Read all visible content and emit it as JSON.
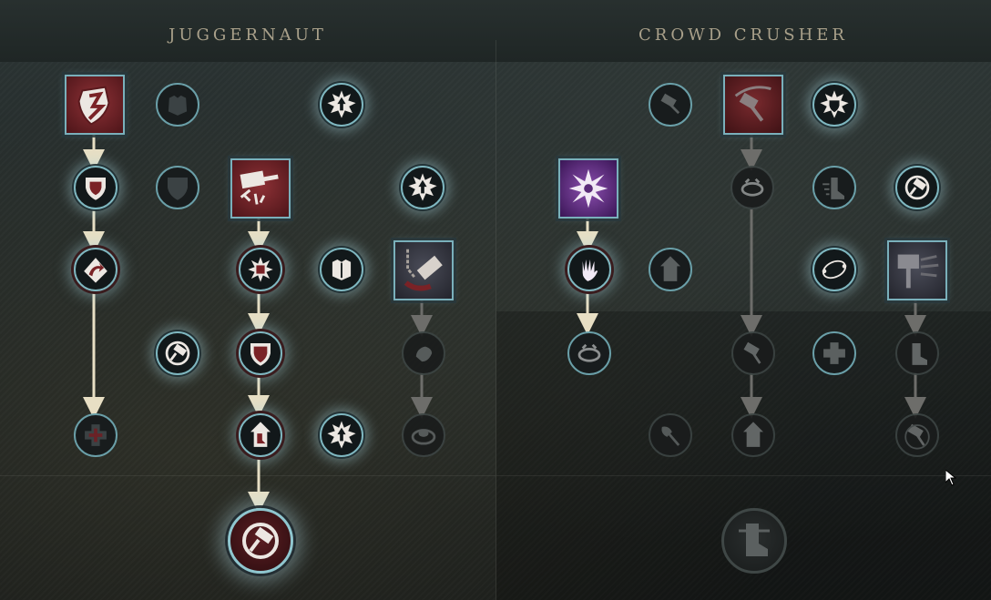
{
  "trees": {
    "left": {
      "title": "JUGGERNAUT"
    },
    "right": {
      "title": "CROWD CRUSHER"
    }
  },
  "colors": {
    "active_ring": "#7fb7c0",
    "arrow_active": "#e8dfc4",
    "arrow_locked": "#6d6d6a",
    "title": "#a9a08a"
  },
  "nodes": {
    "juggernaut": [
      {
        "id": "j-shield-square",
        "icon": "broken-shield-icon",
        "state": "active"
      },
      {
        "id": "j-armor-passive",
        "icon": "armor-icon",
        "state": "passive"
      },
      {
        "id": "j-burst-up",
        "icon": "burst-up-arrow-icon",
        "state": "active"
      },
      {
        "id": "j-shield-heart",
        "icon": "shield-heart-icon",
        "state": "active"
      },
      {
        "id": "j-shield-dark",
        "icon": "shield-icon",
        "state": "passive"
      },
      {
        "id": "j-hammer-square",
        "icon": "hammer-strike-icon",
        "state": "active"
      },
      {
        "id": "j-burst-up-2",
        "icon": "burst-up-arrow-icon",
        "state": "active"
      },
      {
        "id": "j-shield-swap",
        "icon": "shield-arrows-icon",
        "state": "active"
      },
      {
        "id": "j-spiky-burst",
        "icon": "spiky-burst-icon",
        "state": "active"
      },
      {
        "id": "j-breastplate",
        "icon": "breastplate-icon",
        "state": "active"
      },
      {
        "id": "j-hammer-chain",
        "icon": "hammer-chain-icon",
        "state": "active"
      },
      {
        "id": "j-hammer-spin",
        "icon": "hammer-spin-icon",
        "state": "active"
      },
      {
        "id": "j-shield-red",
        "icon": "shield-icon",
        "state": "active"
      },
      {
        "id": "j-fist",
        "icon": "fist-icon",
        "state": "locked"
      },
      {
        "id": "j-cross",
        "icon": "cross-heal-icon",
        "state": "passive"
      },
      {
        "id": "j-boot-up",
        "icon": "boot-up-icon",
        "state": "active"
      },
      {
        "id": "j-burst-up-3",
        "icon": "burst-up-arrow-icon",
        "state": "active"
      },
      {
        "id": "j-swirl",
        "icon": "swirl-icon",
        "state": "locked"
      },
      {
        "id": "j-ultimate",
        "icon": "hammer-spin-icon",
        "state": "active"
      }
    ],
    "crowd_crusher": [
      {
        "id": "c-hammer-swing",
        "icon": "hammer-swing-icon",
        "state": "passive"
      },
      {
        "id": "c-hammer-square",
        "icon": "hammer-throw-icon",
        "state": "passive"
      },
      {
        "id": "c-shield-burst",
        "icon": "shield-burst-icon",
        "state": "active"
      },
      {
        "id": "c-shatter-square",
        "icon": "shatter-icon",
        "state": "active"
      },
      {
        "id": "c-shackle",
        "icon": "shackle-icon",
        "state": "locked"
      },
      {
        "id": "c-boot-speed",
        "icon": "boot-speed-icon",
        "state": "passive"
      },
      {
        "id": "c-hammer-ring",
        "icon": "hammer-spin-icon",
        "state": "active"
      },
      {
        "id": "c-hand",
        "icon": "grab-hand-icon",
        "state": "active"
      },
      {
        "id": "c-boot-house",
        "icon": "boot-up-icon",
        "state": "passive"
      },
      {
        "id": "c-orbit",
        "icon": "orbit-icon",
        "state": "active"
      },
      {
        "id": "c-hammer-quake",
        "icon": "hammer-quake-icon",
        "state": "passive"
      },
      {
        "id": "c-shackle-2",
        "icon": "shackle-icon",
        "state": "passive"
      },
      {
        "id": "c-hammer-hit",
        "icon": "hammer-hit-icon",
        "state": "locked"
      },
      {
        "id": "c-cross",
        "icon": "cross-heal-icon",
        "state": "passive"
      },
      {
        "id": "c-fist-boot",
        "icon": "boot-stomp-icon",
        "state": "locked"
      },
      {
        "id": "c-axe",
        "icon": "axe-icon",
        "state": "locked"
      },
      {
        "id": "c-boot-up",
        "icon": "boot-up-icon",
        "state": "locked"
      },
      {
        "id": "c-hammer-hit-2",
        "icon": "hammer-hit-icon",
        "state": "locked"
      },
      {
        "id": "c-ultimate",
        "icon": "boot-stomp-icon",
        "state": "locked"
      }
    ]
  }
}
